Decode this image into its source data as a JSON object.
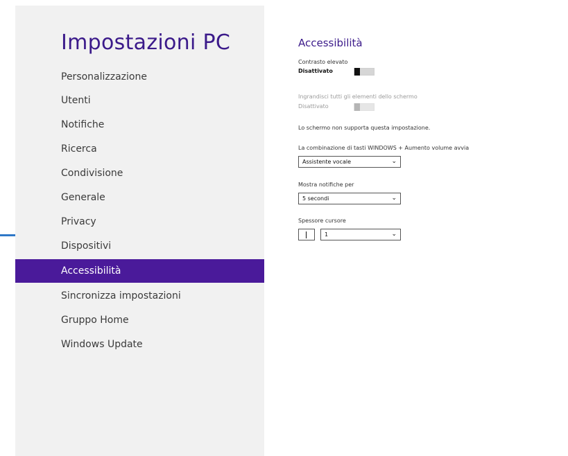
{
  "sidebar": {
    "title": "Impostazioni PC",
    "items": [
      {
        "label": "Personalizzazione"
      },
      {
        "label": "Utenti"
      },
      {
        "label": "Notifiche"
      },
      {
        "label": "Ricerca"
      },
      {
        "label": "Condivisione"
      },
      {
        "label": "Generale"
      },
      {
        "label": "Privacy"
      },
      {
        "label": "Dispositivi"
      },
      {
        "label": "Accessibilità",
        "selected": true
      },
      {
        "label": "Sincronizza impostazioni"
      },
      {
        "label": "Gruppo Home"
      },
      {
        "label": "Windows Update"
      }
    ]
  },
  "content": {
    "title": "Accessibilità",
    "high_contrast": {
      "label": "Contrasto elevato",
      "state": "Disattivato",
      "on": false
    },
    "magnify": {
      "label": "Ingrandisci tutti gli elementi dello schermo",
      "state": "Disattivato",
      "on": false,
      "disabled": true
    },
    "unsupported_note": "Lo schermo non supporta questa impostazione.",
    "win_volume": {
      "label": "La combinazione di tasti WINDOWS + Aumento volume avvia",
      "value": "Assistente vocale"
    },
    "notifications": {
      "label": "Mostra notifiche per",
      "value": "5 secondi"
    },
    "cursor": {
      "label": "Spessore cursore",
      "value": "1"
    }
  },
  "colors": {
    "accent": "#4a1a9a",
    "title": "#3b1a8a",
    "sidebar_bg": "#f1f1f1",
    "edge_accent": "#2e78c7"
  },
  "icons": {
    "dropdown": "chevron-down-icon"
  }
}
